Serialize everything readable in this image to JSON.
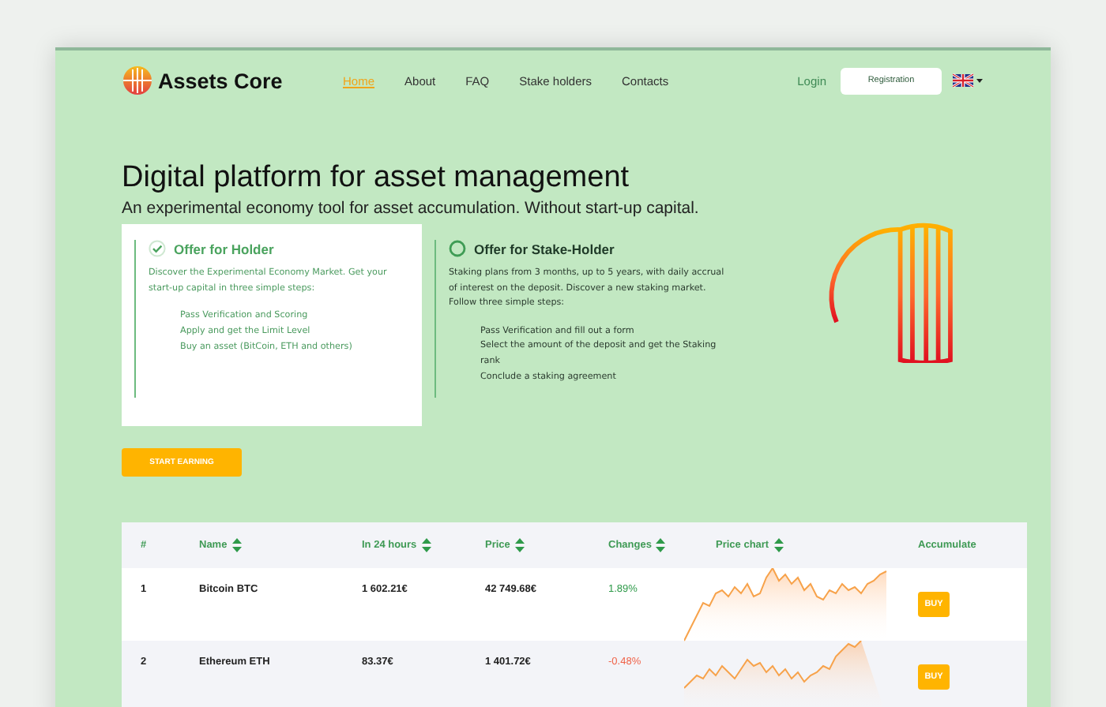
{
  "brand": {
    "name": "Assets Core"
  },
  "nav": [
    {
      "label": "Home",
      "selected": true
    },
    {
      "label": "About",
      "selected": false
    },
    {
      "label": "FAQ",
      "selected": false
    },
    {
      "label": "Stake holders",
      "selected": false
    },
    {
      "label": "Contacts",
      "selected": false
    }
  ],
  "login": "Login",
  "registration": "Registration",
  "hero": {
    "title": "Digital platform for asset management",
    "subtitle": "An experimental economy tool for asset accumulation. Without start-up capital."
  },
  "offers": [
    {
      "title": "Offer for Holder",
      "selected": true,
      "text": "Discover the Experimental Economy Market. Get your start-up capital in three simple steps:",
      "steps": [
        "Pass Verification and Scoring",
        "Apply and get the Limit Level",
        "Buy an asset (BitCoin, ETH and others)"
      ]
    },
    {
      "title": "Offer for Stake-Holder",
      "selected": false,
      "text": "Staking plans from 3 months, up to 5 years, with daily accrual of interest on the deposit. Discover a new staking market. Follow three simple steps:",
      "steps": [
        "Pass Verification and fill out a form",
        "Select the amount of the deposit and get the Staking rank",
        "Conclude a staking agreement"
      ]
    }
  ],
  "cta": "START EARNING",
  "table": {
    "columns": [
      {
        "label": "#",
        "sortable": false
      },
      {
        "label": "Name",
        "sortable": true
      },
      {
        "label": "In 24 hours",
        "sortable": true
      },
      {
        "label": "Price",
        "sortable": true
      },
      {
        "label": "Changes",
        "sortable": true
      },
      {
        "label": "Price chart",
        "sortable": true
      },
      {
        "label": "Accumulate",
        "sortable": false
      }
    ],
    "rows": [
      {
        "rank": "1",
        "name": "Bitcoin BTC",
        "in_24_hours": "1 602.21€",
        "price": "42 749.68€",
        "change": "1.89%",
        "kind": "gain",
        "action": "BUY"
      },
      {
        "rank": "2",
        "name": "Ethereum ETH",
        "in_24_hours": "83.37€",
        "price": "1 401.72€",
        "change": "-0.48%",
        "kind": "loss",
        "action": "BUY"
      }
    ]
  }
}
